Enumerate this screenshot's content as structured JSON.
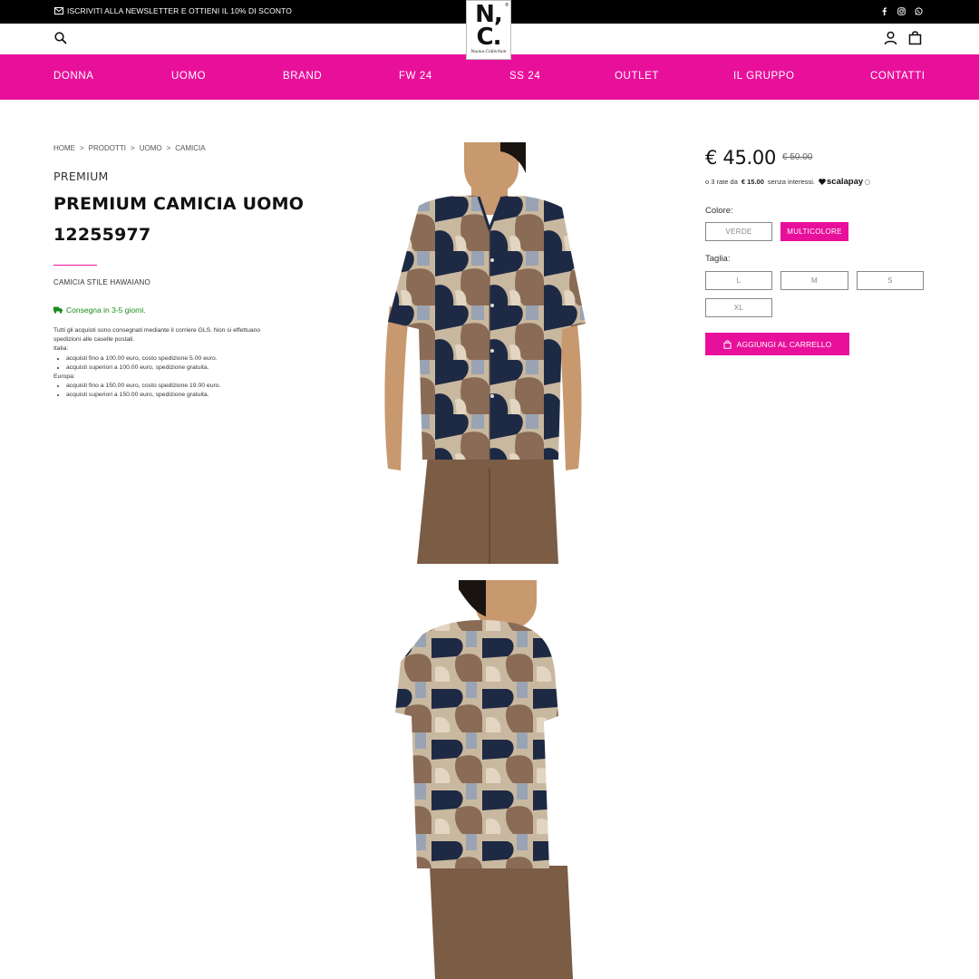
{
  "topbar": {
    "newsletter": "ISCRIVITI ALLA NEWSLETTER E OTTIENI IL 10% DI SCONTO",
    "social_icons": [
      "facebook-icon",
      "instagram-icon",
      "whatsapp-icon"
    ]
  },
  "logo": {
    "mark_line1": "N,",
    "mark_line2": "C.",
    "script": "Nuova Collection",
    "registered": "®"
  },
  "header": {
    "icons": [
      "search-icon",
      "user-icon",
      "shopping-bag-icon"
    ]
  },
  "nav": [
    "DONNA",
    "UOMO",
    "BRAND",
    "FW 24",
    "SS 24",
    "OUTLET",
    "IL GRUPPO",
    "CONTATTI"
  ],
  "breadcrumb": [
    "HOME",
    "PRODOTTI",
    "UOMO",
    "CAMICIA"
  ],
  "breadcrumb_separator": ">",
  "product": {
    "brand": "PREMIUM",
    "title": "PREMIUM CAMICIA UOMO 12255977",
    "subtitle": "CAMICIA STILE HAWAIANO",
    "delivery": "Consegna in 3-5 giorni.",
    "shipping_intro": "Tutti gli acquisti sono consegnati mediante il corriere GLS. Non si effettuano spedizioni alle caselle postali.",
    "italy_label": "Italia:",
    "italy_items": [
      "acquisti fino a 100.00 euro, costo spedizione 5.00 euro.",
      "acquisti superiori a 100.00 euro, spedizione gratuita."
    ],
    "europe_label": "Europa:",
    "europe_items": [
      "acquisti fino a 150.00 euro, costo spedizione 19.00 euro.",
      "acquisti superiori a 150.00 euro, spedizione gratuita."
    ]
  },
  "pricing": {
    "price": "€ 45.00",
    "old_price": "€ 50.00",
    "installments_prefix": "o 3 rate da",
    "installment_amount": "€ 15.00",
    "installments_suffix": "senza interessi.",
    "scalapay": "scalapay"
  },
  "options": {
    "color_label": "Colore:",
    "colors": [
      "VERDE",
      "MULTICOLORE"
    ],
    "selected_color": "MULTICOLORE",
    "size_label": "Taglia:",
    "sizes": [
      "L",
      "M",
      "S",
      "XL"
    ]
  },
  "cart_button": "AGGIUNGI AL CARRELLO",
  "colors": {
    "accent": "#e8109b",
    "topbar": "#000000",
    "delivery_green": "#1a8c1a"
  }
}
